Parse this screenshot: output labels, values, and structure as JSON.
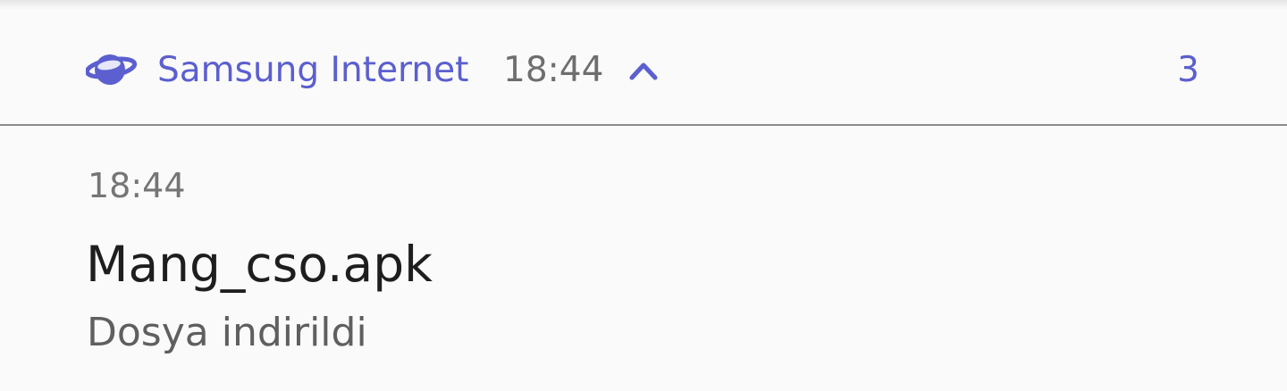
{
  "notification": {
    "header": {
      "app_icon": "samsung-internet-planet-icon",
      "app_name": "Samsung Internet",
      "time": "18:44",
      "expand_icon": "chevron-up-icon",
      "count": "3"
    },
    "body": {
      "time": "18:44",
      "title": "Mang_cso.apk",
      "text": "Dosya indirildi"
    },
    "colors": {
      "accent": "#5b5fcf",
      "background": "#fafafa",
      "divider": "#8a8a8a",
      "title": "#1e1e1e",
      "secondary_text": "#5f5f5f"
    }
  }
}
